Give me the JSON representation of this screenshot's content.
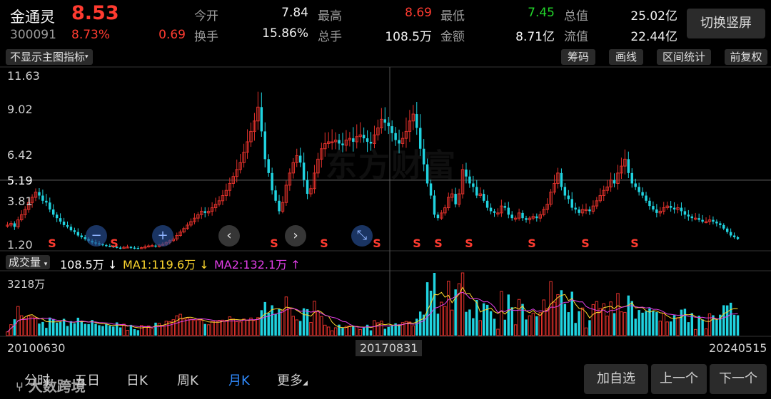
{
  "stock": {
    "name": "金通灵",
    "price": "8.53",
    "code": "300091",
    "change_pct": "8.73%",
    "change": "0.69"
  },
  "stats": [
    {
      "label": "今开",
      "value": "7.84",
      "color": "white"
    },
    {
      "label": "最高",
      "value": "8.69",
      "color": "red"
    },
    {
      "label": "最低",
      "value": "7.45",
      "color": "green"
    },
    {
      "label": "总值",
      "value": "25.02亿",
      "color": "white"
    },
    {
      "label": "换手",
      "value": "15.86%",
      "color": "white"
    },
    {
      "label": "总手",
      "value": "108.5万",
      "color": "white"
    },
    {
      "label": "金额",
      "value": "8.71亿",
      "color": "white"
    },
    {
      "label": "流值",
      "value": "22.44亿",
      "color": "white"
    }
  ],
  "header": {
    "switch_label": "切换竖屏"
  },
  "toolbar": {
    "indicator_select": "不显示主图指标",
    "buttons": [
      "筹码",
      "画线",
      "区间统计",
      "前复权"
    ]
  },
  "price_axis": {
    "labels": [
      "11.63",
      "9.02",
      "6.42",
      "5.19",
      "3.81",
      "1.20"
    ]
  },
  "volume_panel": {
    "select_label": "成交量",
    "vol": "108.5万 ↓",
    "ma1": "MA1:119.6万 ↓",
    "ma2": "MA2:132.1万 ↑",
    "axis_max": "3218万"
  },
  "date_axis": {
    "start": "20100630",
    "mid": "20170831",
    "end": "20240515"
  },
  "sell_marker": "S",
  "controls": [
    "zoom-out-icon",
    "zoom-in-icon",
    "chevron-left-icon",
    "chevron-right-icon",
    "collapse-icon"
  ],
  "tabs": [
    {
      "label": "分时",
      "active": false
    },
    {
      "label": "五日",
      "active": false
    },
    {
      "label": "日K",
      "active": false
    },
    {
      "label": "周K",
      "active": false
    },
    {
      "label": "月K",
      "active": true
    },
    {
      "label": "更多",
      "active": false
    }
  ],
  "bottom_buttons": [
    "加自选",
    "上一个",
    "下一个"
  ],
  "watermark": "东方财富",
  "corner_watermark": "大数跨境",
  "colors": {
    "up": "#e0312b",
    "down": "#20d3e0",
    "ma1": "#ffd82e",
    "ma2": "#e23ee8",
    "accent": "#2f8bff"
  },
  "chart_data": {
    "type": "candlestick",
    "title": "",
    "xlabel": "",
    "ylabel": "",
    "x_range": [
      "2010-06",
      "2024-05"
    ],
    "ylim": [
      1.2,
      11.63
    ],
    "current_price_line": 5.19,
    "closes": [
      2.6,
      2.7,
      2.5,
      2.9,
      3.2,
      3.5,
      3.9,
      4.2,
      4.5,
      4.3,
      4.0,
      3.9,
      3.5,
      3.2,
      3.0,
      2.8,
      2.6,
      2.5,
      2.3,
      2.2,
      2.0,
      1.9,
      1.8,
      1.7,
      1.6,
      1.55,
      1.5,
      1.45,
      1.4,
      1.38,
      1.35,
      1.3,
      1.28,
      1.32,
      1.34,
      1.3,
      1.28,
      1.26,
      1.3,
      1.35,
      1.4,
      1.42,
      1.36,
      1.45,
      1.5,
      1.6,
      1.7,
      1.8,
      2.0,
      2.2,
      2.4,
      2.6,
      2.8,
      3.0,
      3.2,
      3.4,
      3.3,
      3.4,
      3.6,
      3.8,
      4.0,
      4.3,
      4.6,
      5.0,
      5.4,
      5.8,
      6.2,
      6.8,
      7.4,
      8.0,
      8.6,
      9.4,
      8.0,
      6.4,
      5.6,
      4.6,
      4.0,
      3.4,
      3.9,
      4.9,
      5.6,
      6.2,
      6.6,
      6.2,
      5.2,
      4.4,
      4.7,
      5.6,
      6.4,
      7.0,
      7.3,
      7.4,
      7.4,
      7.5,
      7.3,
      7.2,
      7.5,
      7.6,
      7.4,
      7.7,
      7.8,
      7.6,
      7.4,
      7.3,
      7.8,
      8.2,
      8.7,
      8.5,
      8.3,
      7.9,
      7.5,
      7.3,
      7.6,
      8.0,
      8.6,
      9.0,
      8.2,
      7.0,
      6.1,
      5.0,
      4.3,
      3.2,
      3.0,
      3.3,
      3.6,
      4.2,
      4.4,
      3.8,
      4.4,
      5.8,
      5.4,
      5.0,
      4.8,
      4.3,
      4.4,
      4.0,
      3.6,
      3.4,
      3.3,
      3.3,
      3.7,
      3.6,
      3.2,
      3.0,
      3.0,
      3.3,
      3.0,
      2.9,
      3.0,
      3.1,
      3.0,
      3.2,
      3.5,
      3.8,
      4.5,
      5.0,
      5.6,
      4.8,
      4.3,
      4.1,
      3.6,
      3.5,
      3.3,
      3.5,
      3.5,
      3.4,
      3.7,
      4.0,
      4.3,
      4.6,
      4.8,
      5.2,
      5.0,
      5.6,
      6.0,
      6.4,
      5.6,
      5.0,
      4.8,
      4.5,
      4.3,
      4.0,
      3.7,
      3.5,
      3.3,
      3.4,
      3.6,
      3.7,
      3.6,
      3.5,
      3.6,
      3.4,
      3.2,
      3.1,
      3.0,
      3.0,
      2.9,
      2.8,
      2.8,
      2.9,
      2.8,
      2.7,
      2.6,
      2.4,
      2.2,
      2.0,
      1.9,
      1.8
    ],
    "volume_ma1_line": true,
    "volume_ma2_line": true
  }
}
